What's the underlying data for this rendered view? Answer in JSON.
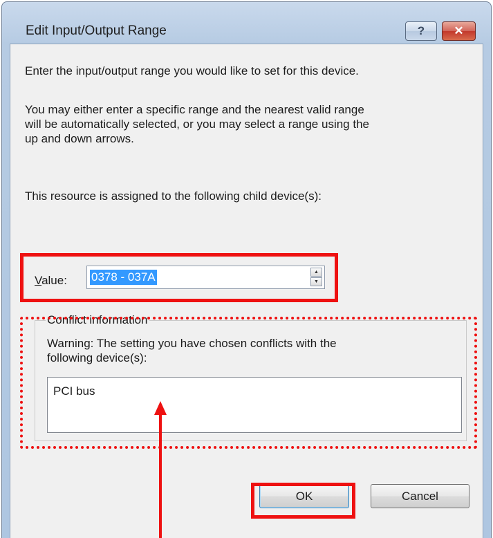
{
  "window": {
    "title": "Edit Input/Output Range",
    "help_button_label": "?",
    "close_button_label": "✕"
  },
  "dialog": {
    "intro_text": "Enter the input/output range you would like to set for this device.",
    "instructions_lines": [
      "You may either enter a specific range and the nearest valid range",
      "will be automatically selected, or you may select a range using the",
      "up and down arrows."
    ],
    "child_devices_text": "This resource is assigned to the following child device(s):",
    "value_label_accel": "V",
    "value_label_rest": "alue:",
    "value": "0378 - 037A",
    "spin_up_glyph": "▲",
    "spin_down_glyph": "▼",
    "conflict_group_label": "Conflict information",
    "warning_lines": [
      "Warning: The setting you have chosen conflicts with the",
      "following device(s):"
    ],
    "conflict_devices": [
      "PCI bus"
    ],
    "ok_label": "OK",
    "cancel_label": "Cancel"
  },
  "annotations": {
    "color": "#ee1111"
  }
}
